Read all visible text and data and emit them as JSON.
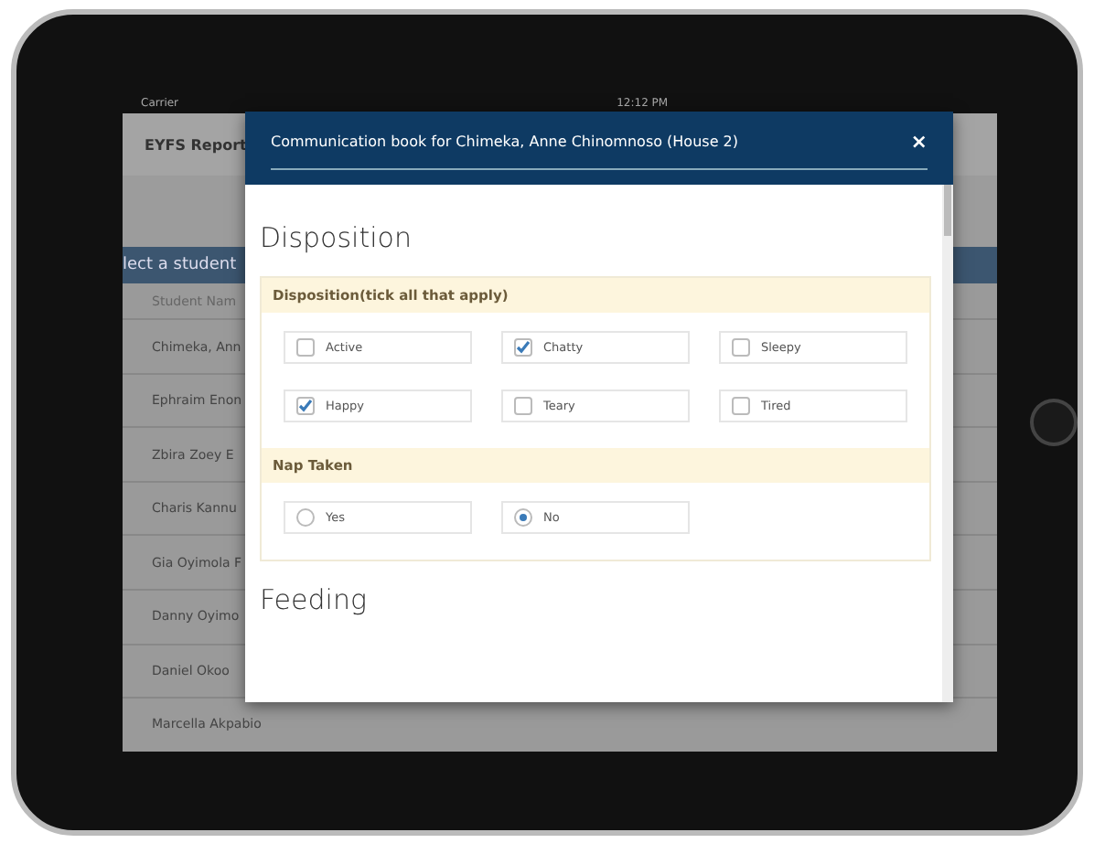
{
  "status_bar": {
    "carrier": "Carrier",
    "time": "12:12 PM"
  },
  "app": {
    "title": "EYFS Report",
    "banner": "lect a student",
    "column_header": "Student Nam",
    "students": [
      "Chimeka, Ann",
      "Ephraim Enon",
      "Zbira Zoey E",
      "Charis Kannu",
      "Gia Oyimola F",
      "Danny Oyimo",
      "Daniel Okoo",
      "Marcella Akpabio"
    ]
  },
  "modal": {
    "title": "Communication book for Chimeka, Anne Chinomnoso (House 2)",
    "close": "×",
    "sections": [
      {
        "heading": "Disposition",
        "groups": [
          {
            "label": "Disposition(tick all that apply)",
            "kind": "checkbox",
            "options": [
              {
                "label": "Active",
                "checked": false
              },
              {
                "label": "Chatty",
                "checked": true
              },
              {
                "label": "Sleepy",
                "checked": false
              },
              {
                "label": "Happy",
                "checked": true
              },
              {
                "label": "Teary",
                "checked": false
              },
              {
                "label": "Tired",
                "checked": false
              }
            ]
          },
          {
            "label": "Nap Taken",
            "kind": "radio",
            "options": [
              {
                "label": "Yes",
                "selected": false
              },
              {
                "label": "No",
                "selected": true
              }
            ]
          }
        ]
      },
      {
        "heading": "Feeding"
      }
    ]
  }
}
